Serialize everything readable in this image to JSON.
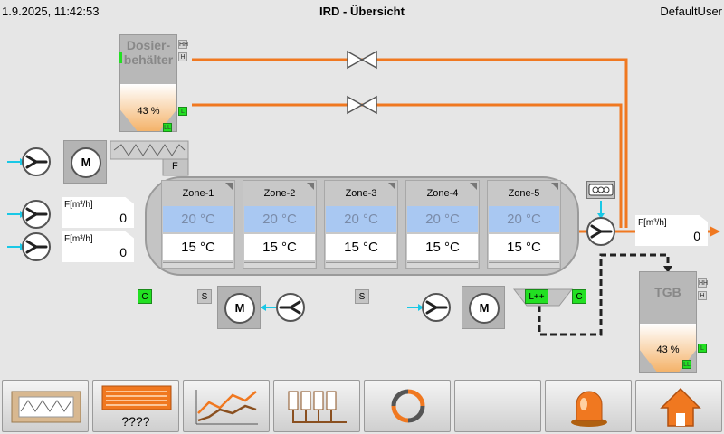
{
  "header": {
    "datetime": "1.9.2025, 11:42:53",
    "title": "IRD - Übersicht",
    "user": "DefaultUser"
  },
  "dosing_tank": {
    "title_line1": "Dosier-",
    "title_line2": "behälter",
    "percent": "43 %",
    "level_fraction": 0.43,
    "levels": {
      "hh": "HH",
      "h": "H",
      "l": "L",
      "ll": "LL"
    }
  },
  "tgb_tank": {
    "title": "TGB",
    "percent": "43 %",
    "level_fraction": 0.43,
    "levels": {
      "hh": "HH",
      "h": "H",
      "l": "L",
      "ll": "LL"
    }
  },
  "feeder_label": "F",
  "motor_label": "M",
  "flows": [
    {
      "label": "F[m³/h]",
      "value": "0"
    },
    {
      "label": "F[m³/h]",
      "value": "0"
    },
    {
      "label": "F[m³/h]",
      "value": "0"
    }
  ],
  "zones": [
    {
      "name": "Zone-1",
      "setpoint": "20 °C",
      "actual": "15 °C"
    },
    {
      "name": "Zone-2",
      "setpoint": "20 °C",
      "actual": "15 °C"
    },
    {
      "name": "Zone-3",
      "setpoint": "20 °C",
      "actual": "15 °C"
    },
    {
      "name": "Zone-4",
      "setpoint": "20 °C",
      "actual": "15 °C"
    },
    {
      "name": "Zone-5",
      "setpoint": "20 °C",
      "actual": "15 °C"
    }
  ],
  "indicators": {
    "c_left": "C",
    "c_right": "C",
    "s_left": "S",
    "s_mid": "S",
    "l_plus": "L++"
  },
  "nav": {
    "recipe_label": "????"
  },
  "colors": {
    "pipe_orange": "#f07820",
    "inlet_cyan": "#19c8e6",
    "status_green": "#22e022",
    "setpoint_blue": "#a9c8f2"
  }
}
